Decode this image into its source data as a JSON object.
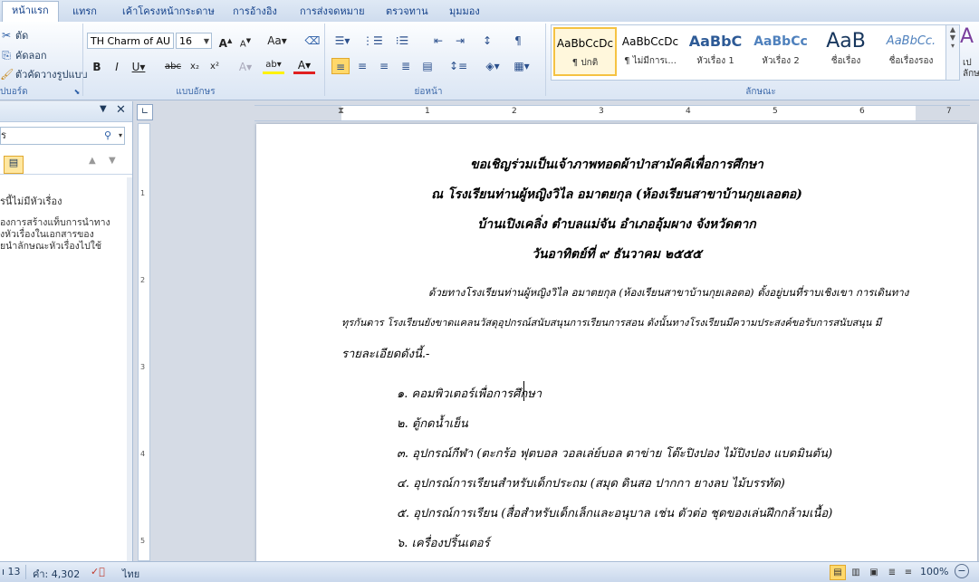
{
  "tabs": [
    "หน้าแรก",
    "แทรก",
    "เค้าโครงหน้ากระดาษ",
    "การอ้างอิง",
    "การส่งจดหมาย",
    "ตรวจทาน",
    "มุมมอง"
  ],
  "clipboard": {
    "cut": "ตัด",
    "copy": "คัดลอก",
    "format_painter": "ตัวคัดวางรูปแบบ",
    "label": "คลิปบอร์ด",
    "label_visible": "ปบอร์ด"
  },
  "font": {
    "name": "TH Charm of AU",
    "size": "16",
    "label": "แบบอักษร"
  },
  "paragraph": {
    "label": "ย่อหน้า"
  },
  "styles": {
    "label": "ลักษณะ",
    "items": [
      {
        "sample": "AaBbCcDc",
        "name": "¶ ปกติ"
      },
      {
        "sample": "AaBbCcDc",
        "name": "¶ ไม่มีการเ..."
      },
      {
        "sample": "AaBbC",
        "name": "หัวเรื่อง 1"
      },
      {
        "sample": "AaBbCc",
        "name": "หัวเรื่อง 2"
      },
      {
        "sample": "AaB",
        "name": "ชื่อเรื่อง"
      },
      {
        "sample": "AaBbCc.",
        "name": "ชื่อเรื่องรอง"
      }
    ],
    "change_label": "เป",
    "change_label2": "ลักษ"
  },
  "nav": {
    "search": "ร",
    "no_headings": "รนี้ไม่มีหัวเรื่อง",
    "hint_lines": [
      "องการสร้างแท็บการนำทาง",
      "งหัวเรื่องในเอกสารของ",
      "ยนำลักษณะหัวเรื่องไปใช้"
    ]
  },
  "document": {
    "heading_lines": [
      "ขอเชิญร่วมเป็นเจ้าภาพทอดผ้าป่าสามัคคีเพื่อการศึกษา",
      "ณ โรงเรียนท่านผู้หญิงวิไล อมาตยกุล (ห้องเรียนสาขาบ้านกุยเลอตอ)",
      "บ้านเปิงเคลิ่ง ตำบลแม่จัน อำเภออุ้มผาง จังหวัดตาก",
      "วันอาทิตย์ที่ ๙ ธันวาคม ๒๕๕๕"
    ],
    "body_lines": [
      "ด้วยทางโรงเรียนท่านผู้หญิงวิไล อมาตยกุล (ห้องเรียนสาขาบ้านกุยเลอตอ) ตั้งอยู่บนที่ราบเชิงเขา การเดินทาง",
      "ทุรกันดาร โรงเรียนยังขาดแคลนวัสดุอุปกรณ์สนับสนุนการเรียนการสอน ดังนั้นทางโรงเรียนมีความประสงค์ขอรับการสนับสนุน มี",
      "รายละเอียดดังนี้.-"
    ],
    "list_items": [
      "๑. คอมพิวเตอร์เพื่อการศึกษา",
      "๒. ตู้กดน้ำเย็น",
      "๓. อุปกรณ์กีฬา (ตะกร้อ ฟุตบอล วอลเล่ย์บอล ตาข่าย โต๊ะปิงปอง ไม้ปิงปอง แบดมินตัน)",
      "๔. อุปกรณ์การเรียนสำหรับเด็กประถม (สมุด ดินสอ ปากกา ยางลบ ไม้บรรทัด)",
      "๕. อุปกรณ์การเรียน (สื่อสำหรับเด็กเล็กและอนุบาล เช่น ตัวต่อ ชุดของเล่นฝึกกล้ามเนื้อ)",
      "๖. เครื่องปริ้นเตอร์"
    ]
  },
  "ruler_numbers": [
    "1",
    "2",
    "3",
    "4",
    "5",
    "6",
    "7"
  ],
  "vruler_numbers": [
    "1",
    "2",
    "3",
    "4",
    "5"
  ],
  "status": {
    "page": "ı 13",
    "words": "คำ: 4,302",
    "language": "ไทย",
    "zoom": "100%"
  }
}
